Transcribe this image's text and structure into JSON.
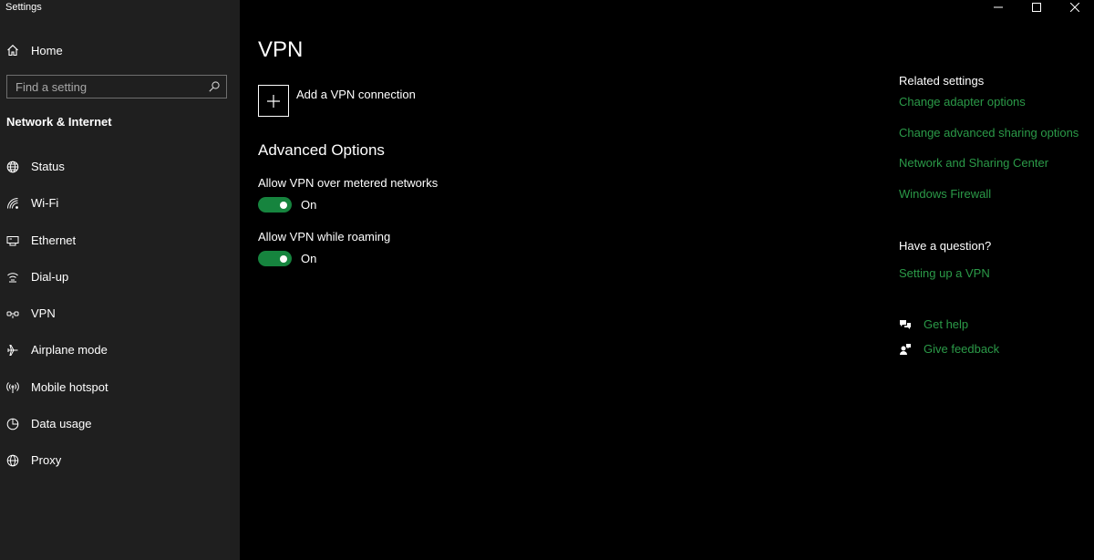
{
  "window": {
    "title": "Settings"
  },
  "sidebar": {
    "home_label": "Home",
    "search_placeholder": "Find a setting",
    "section_title": "Network & Internet",
    "items": [
      {
        "label": "Status",
        "icon": "globe-icon"
      },
      {
        "label": "Wi-Fi",
        "icon": "wifi-icon"
      },
      {
        "label": "Ethernet",
        "icon": "ethernet-icon"
      },
      {
        "label": "Dial-up",
        "icon": "dialup-icon"
      },
      {
        "label": "VPN",
        "icon": "vpn-icon"
      },
      {
        "label": "Airplane mode",
        "icon": "airplane-icon"
      },
      {
        "label": "Mobile hotspot",
        "icon": "hotspot-icon"
      },
      {
        "label": "Data usage",
        "icon": "data-usage-icon"
      },
      {
        "label": "Proxy",
        "icon": "proxy-globe-icon"
      }
    ]
  },
  "main": {
    "title": "VPN",
    "add_vpn_label": "Add a VPN connection",
    "advanced_title": "Advanced Options",
    "options": [
      {
        "label": "Allow VPN over metered networks",
        "state": "On"
      },
      {
        "label": "Allow VPN while roaming",
        "state": "On"
      }
    ]
  },
  "right": {
    "related_heading": "Related settings",
    "related_links": [
      "Change adapter options",
      "Change advanced sharing options",
      "Network and Sharing Center",
      "Windows Firewall"
    ],
    "question_heading": "Have a question?",
    "question_link": "Setting up a VPN",
    "get_help": "Get help",
    "give_feedback": "Give feedback"
  },
  "colors": {
    "accent_green": "#2b9a48",
    "toggle_on": "#16843e",
    "sidebar_bg": "#1f1f1f",
    "main_bg": "#000000"
  }
}
